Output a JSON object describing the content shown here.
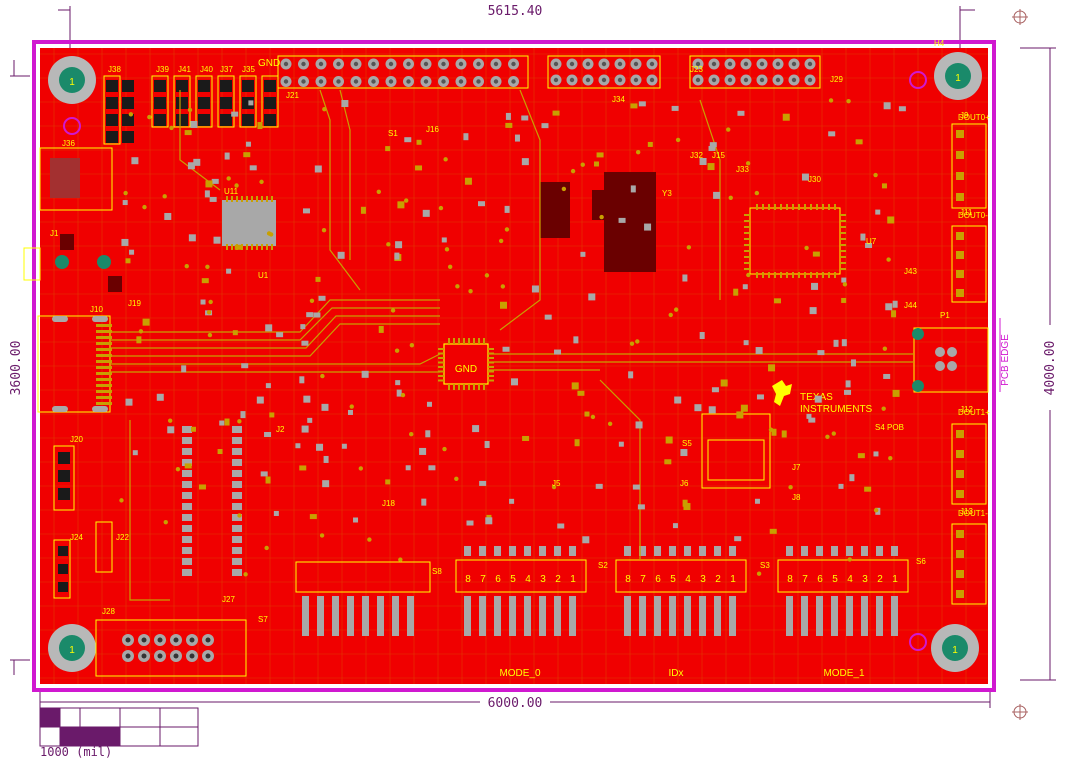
{
  "dimensions": {
    "top_width": "5615.40",
    "bottom_width": "6000.00",
    "left_height": "3600.00",
    "right_height": "4000.00"
  },
  "pcb_edge_label": "PCB EDGE",
  "scale_label": "1000 (mil)",
  "logo": {
    "line1": "TEXAS",
    "line2": "INSTRUMENTS"
  },
  "gnd_label": "GND",
  "center_chip_label": "GND",
  "switch_labels": [
    "MODE_0",
    "IDx",
    "MODE_1"
  ],
  "connector_labels": [
    "J38",
    "J39",
    "J41",
    "J40",
    "J37",
    "J35",
    "J21",
    "J23",
    "J29",
    "J36",
    "J1",
    "J10",
    "J20",
    "J24",
    "J28",
    "J27",
    "J9",
    "J11",
    "J12",
    "J13",
    "P1",
    "H4",
    "U11",
    "U1",
    "U7",
    "S1",
    "S2",
    "S3",
    "S4 POB",
    "S5",
    "S6",
    "S7",
    "S8",
    "Y3",
    "J19",
    "J2",
    "J5",
    "J6",
    "J7",
    "J8",
    "J16",
    "J34",
    "J33",
    "J30",
    "J43",
    "J44",
    "J22",
    "J18",
    "J32",
    "J15"
  ],
  "output_labels": [
    "DOUT0+",
    "DOUT0-",
    "DOUT1+",
    "DOUT1-"
  ],
  "switch_digits": [
    "8",
    "7",
    "6",
    "5",
    "4",
    "3",
    "2",
    "1"
  ],
  "mounting_hole_label": "1",
  "colors": {
    "board": "#f00000",
    "outline": "#d018d0",
    "silkscreen": "#ffff00",
    "copper": "#c8a000",
    "pad": "#a8a8a8",
    "dark_copper": "#6a0000",
    "dimension": "#6a1a6a"
  }
}
